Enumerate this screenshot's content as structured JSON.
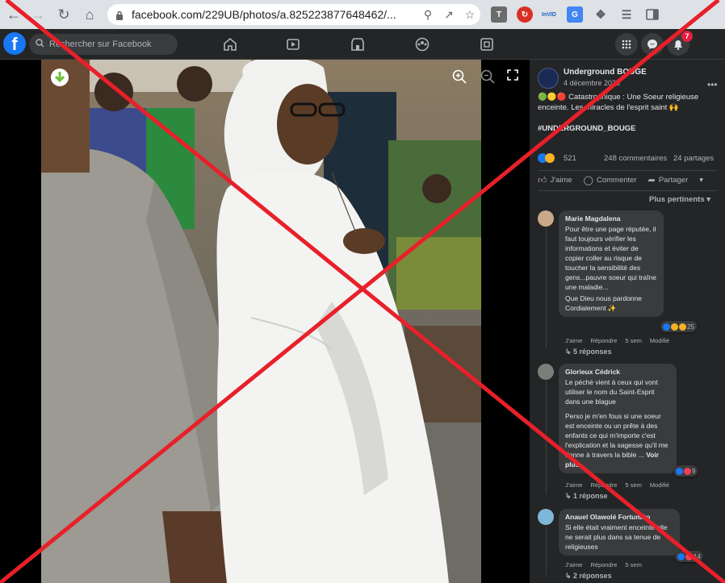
{
  "browser": {
    "url": "facebook.com/229UB/photos/a.825223877648462/...",
    "extensions": [
      "T",
      "InVID"
    ]
  },
  "fb": {
    "search_placeholder": "Rechercher sur Facebook",
    "notification_count": "7"
  },
  "post": {
    "page_name": "Underground BOUGE",
    "date": "4 décembre 2023",
    "text": "🟢🟡🔴 Catastrophique : Une Soeur religieuse enceinte. Les miracles de l'esprit saint 🙌",
    "hashtag": "#UNDERGROUND_BOUGE",
    "reactions_count": "521",
    "comments_count": "248 commentaires",
    "shares_count": "24 partages",
    "like_label": "J'aime",
    "comment_label": "Commenter",
    "share_label": "Partager",
    "sort_label": "Plus pertinents"
  },
  "comments": [
    {
      "author": "Marie Magdalena",
      "text": "Pour être une page réputée, il faut toujours vérifier les informations et éviter de copier coller au risque de toucher la sensibilité des gens...pauvre soeur qui traîne une maladie...",
      "text2": "Que Dieu nous pardonne Cordialement ✨",
      "reactions": "25",
      "like": "J'aime",
      "reply": "Répondre",
      "time": "5 sem",
      "edited": "Modifié",
      "replies": "5 réponses"
    },
    {
      "author": "Glorieux Cédrick",
      "text": "Le péché vient à ceux qui vont utiliser le nom du Saint-Esprit dans une blague",
      "text2": "Perso je m'en fous si une soeur est enceinte ou un prête à des enfants ce qui m'importe c'est l'explication et la sagesse qu'il me donne à travers la bible ...",
      "see_more": "Voir plus",
      "reactions": "9",
      "like": "J'aime",
      "reply": "Répondre",
      "time": "5 sem",
      "edited": "Modifié",
      "replies": "1 réponse"
    },
    {
      "author": "Anauel Olawolé Fortunato",
      "text": "Si elle était vraiment enceinte elle ne serait plus dans sa tenue de religieuses",
      "reactions": "14",
      "like": "J'aime",
      "reply": "Répondre",
      "time": "5 sem",
      "replies": "2 réponses"
    }
  ],
  "colors": {
    "fb_blue": "#1877f2",
    "panel_bg": "#242526",
    "red_x": "#e8202a"
  }
}
